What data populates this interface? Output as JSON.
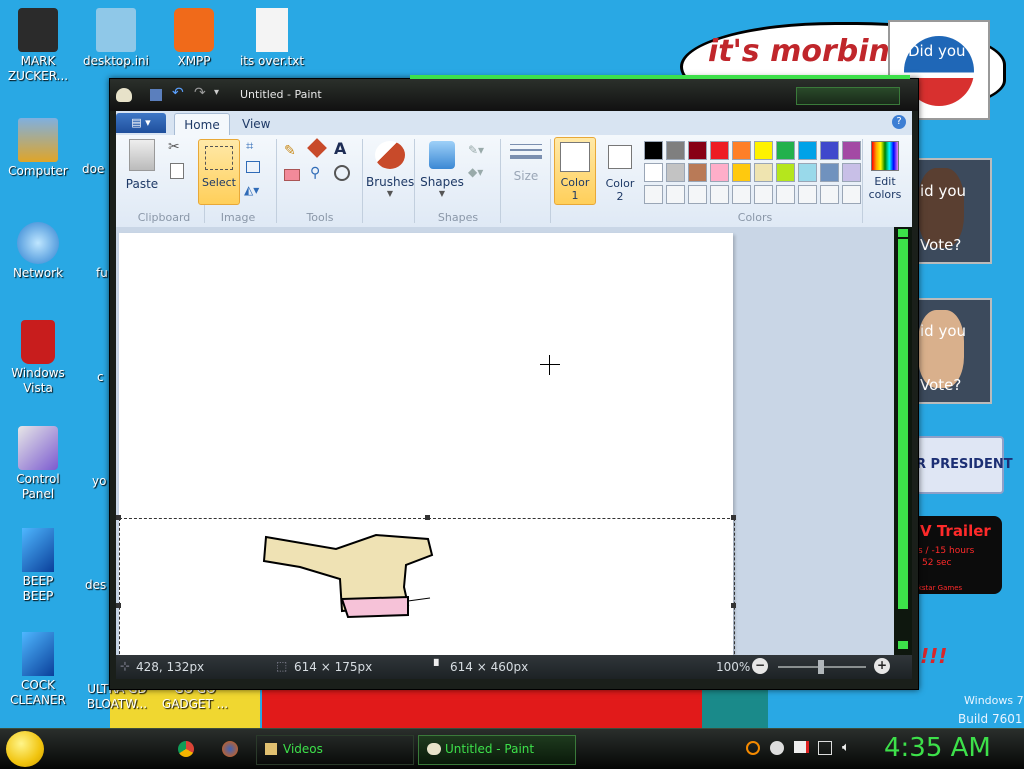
{
  "desktop": {
    "icons_left": [
      {
        "label": "MARK ZUCKER...",
        "icon": "portrait-icon"
      },
      {
        "label": "Computer",
        "icon": "computer-icon"
      },
      {
        "label": "Network",
        "icon": "network-globe-icon"
      },
      {
        "label": "Windows Vista",
        "icon": "recycle-bin-icon"
      },
      {
        "label": "Control Panel",
        "icon": "control-panel-icon"
      },
      {
        "label": "BEEP BEEP",
        "icon": "app-box-icon"
      },
      {
        "label": "COCK CLEANER",
        "icon": "app-box-icon"
      }
    ],
    "icons_second": [
      {
        "label": "desktop.ini",
        "icon": "settings-file-icon"
      },
      {
        "label": "doe",
        "icon": "app-icon"
      },
      {
        "label": "fu",
        "icon": "app-icon"
      },
      {
        "label": "c",
        "icon": "app-icon"
      },
      {
        "label": "yo",
        "icon": "folder-icon"
      },
      {
        "label": "des",
        "icon": "app-icon"
      },
      {
        "label": "ULTRA GD BLOATW...",
        "icon": "app-icon"
      }
    ],
    "icons_top": [
      {
        "label": "XMPP",
        "icon": "xampp-icon"
      },
      {
        "label": "its over.txt",
        "icon": "text-file-icon"
      }
    ],
    "icon_gadget": {
      "label": "GO GO GADGET ...",
      "icon": "app-icon"
    },
    "wallpaper": {
      "speech_bubble": "it's morbin t",
      "vote_top": "Did you",
      "vote1_a": "id you",
      "vote1_b": "Vote?",
      "vote2_a": "id you",
      "vote2_b": "Vote?",
      "president": "R PRESIDENT",
      "trailer_title": "V Trailer",
      "trailer_line1": "s / -15 hours",
      "trailer_line2": "52 sec",
      "trailer_line3": "ckstar Games",
      "exclaim": "!!!",
      "win_version": "Windows 7",
      "build": "Build 7601"
    }
  },
  "paint": {
    "title": "Untitled - Paint",
    "tabs": [
      "Home",
      "View"
    ],
    "groups": {
      "clipboard": "Clipboard",
      "image": "Image",
      "tools": "Tools",
      "shapes": "Shapes",
      "colors": "Colors"
    },
    "buttons": {
      "paste": "Paste",
      "select": "Select",
      "brushes": "Brushes",
      "shapes": "Shapes",
      "size": "Size",
      "color1": "Color 1",
      "color1_line1": "Color",
      "color1_line2": "1",
      "color2_line1": "Color",
      "color2_line2": "2",
      "edit_colors_line1": "Edit",
      "edit_colors_line2": "colors"
    },
    "palette_row1": [
      "#000000",
      "#7f7f7f",
      "#880015",
      "#ed1c24",
      "#ff7f27",
      "#fff200",
      "#22b14c",
      "#00a2e8",
      "#3f48cc",
      "#a349a4"
    ],
    "palette_row2": [
      "#ffffff",
      "#c3c3c3",
      "#b97a57",
      "#ffaec9",
      "#ffc90e",
      "#efe4b0",
      "#b5e61d",
      "#99d9ea",
      "#7092be",
      "#c8bfe7"
    ],
    "status": {
      "cursor": "428, 132px",
      "selection": "614 × 175px",
      "canvas": "614 × 460px",
      "zoom": "100%"
    }
  },
  "taskbar": {
    "videos": "Videos",
    "paint": "Untitled - Paint",
    "clock": "4:35 AM"
  }
}
